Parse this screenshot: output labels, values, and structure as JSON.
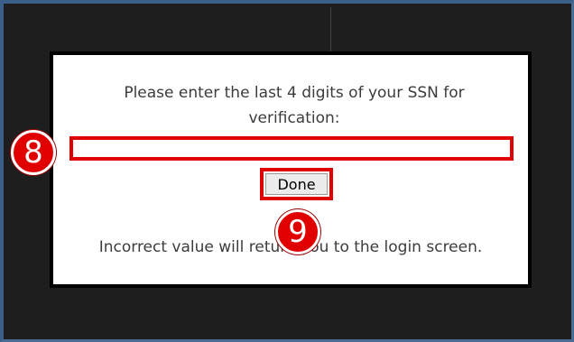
{
  "dialog": {
    "prompt": "Please enter the last 4 digits of your SSN for verification:",
    "input_value": "",
    "done_label": "Done",
    "warning": "Incorrect value will return you to the login screen."
  },
  "annotations": {
    "callout_input": "8",
    "callout_done": "9",
    "highlight_color": "#e00000"
  }
}
